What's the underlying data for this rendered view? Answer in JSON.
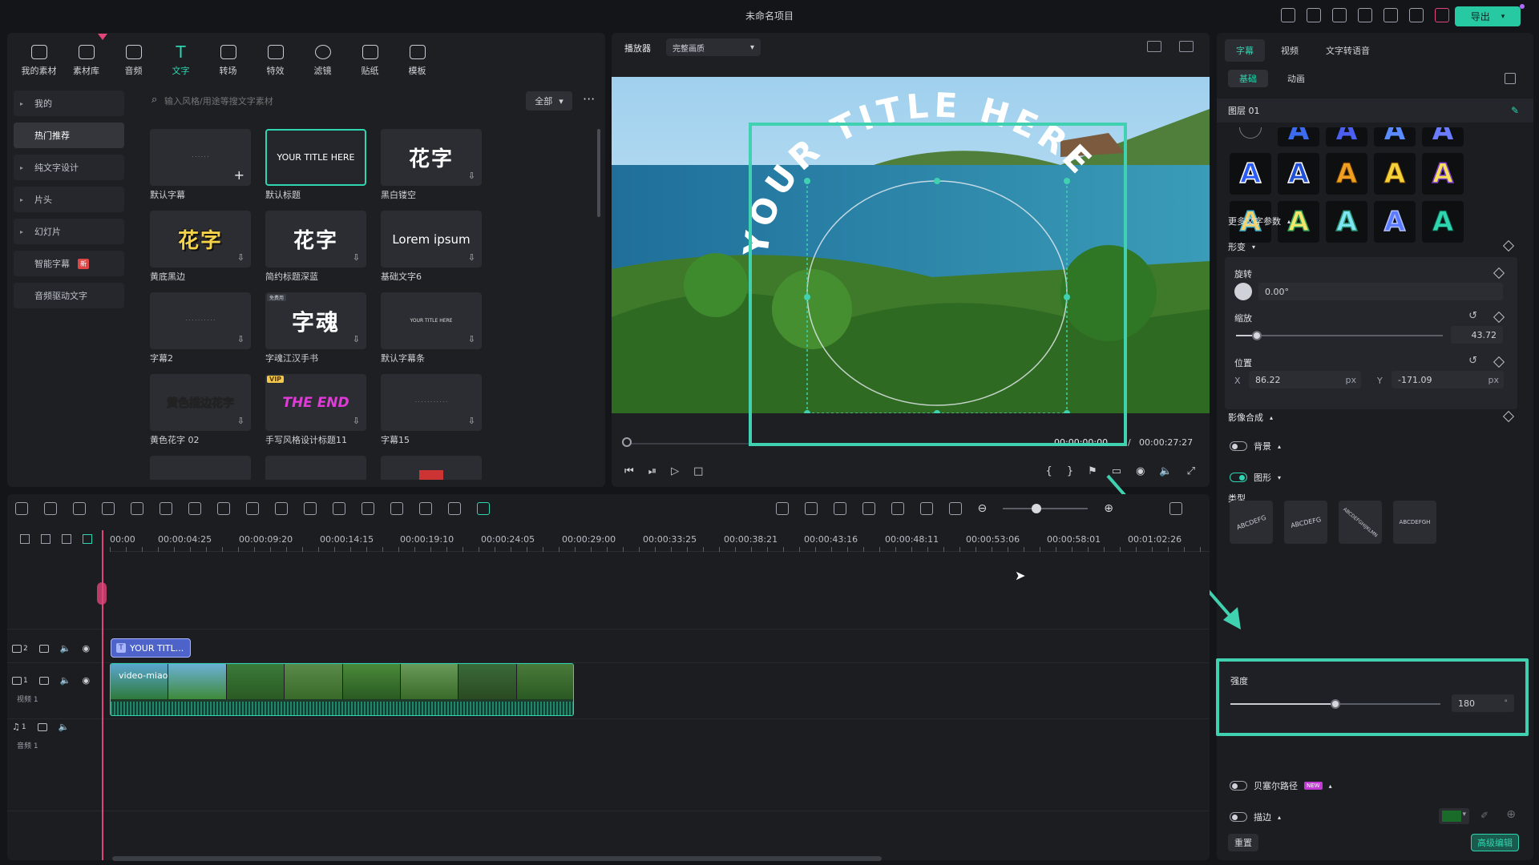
{
  "app": {
    "title": "未命名项目",
    "export_label": "导出"
  },
  "library": {
    "tools": [
      {
        "label": "我的素材",
        "icon": "my-media-icon"
      },
      {
        "label": "素材库",
        "icon": "stock-icon"
      },
      {
        "label": "音频",
        "icon": "audio-icon"
      },
      {
        "label": "文字",
        "icon": "text-icon"
      },
      {
        "label": "转场",
        "icon": "transition-icon"
      },
      {
        "label": "特效",
        "icon": "effects-icon"
      },
      {
        "label": "滤镜",
        "icon": "filter-icon"
      },
      {
        "label": "贴纸",
        "icon": "sticker-icon"
      },
      {
        "label": "模板",
        "icon": "template-icon"
      }
    ],
    "categories": [
      "我的",
      "热门推荐",
      "纯文字设计",
      "片头",
      "幻灯片",
      "智能字幕",
      "音频驱动文字"
    ],
    "smart_badge": "新",
    "search_placeholder": "输入风格/用途等搜文字素材",
    "filter_label": "全部",
    "cards": [
      {
        "label": "默认字幕",
        "preview": ""
      },
      {
        "label": "默认标题",
        "preview": "YOUR TITLE HERE"
      },
      {
        "label": "黑白镂空",
        "preview": "花字"
      },
      {
        "label": "黄底黑边",
        "preview": "花字"
      },
      {
        "label": "简约标题深蓝",
        "preview": "花字"
      },
      {
        "label": "基础文字6",
        "preview": "Lorem ipsum"
      },
      {
        "label": "字幕2",
        "preview": ""
      },
      {
        "label": "字魂江汉手书",
        "preview": "字魂"
      },
      {
        "label": "默认字幕条",
        "preview": "YOUR TITLE HERE"
      },
      {
        "label": "黄色花字 02",
        "preview": "黄色描边花字"
      },
      {
        "label": "手写风格设计标题11",
        "preview": "THE END"
      },
      {
        "label": "字幕15",
        "preview": ""
      }
    ],
    "vip": "VIP",
    "free_tag": "免费用"
  },
  "player": {
    "label": "播放器",
    "quality": "完整画质",
    "overlay_text": "YOUR TITLE HERE",
    "current_time": "00:00:00:00",
    "total_time": "00:00:27:27",
    "separator": "/"
  },
  "inspector": {
    "tabs": [
      "字幕",
      "视频",
      "文字转语音"
    ],
    "subtabs": [
      "基础",
      "动画"
    ],
    "layer": "图层 01",
    "more_params": "更多文字参数",
    "transform": "形变",
    "rotate_label": "旋转",
    "rotate_value": "0.00°",
    "scale_label": "缩放",
    "scale_value": "43.72",
    "scale_fraction": 0.1,
    "position_label": "位置",
    "pos_x_label": "X",
    "pos_x": "86.22",
    "pos_y_label": "Y",
    "pos_y": "-171.09",
    "unit_px": "px",
    "compositing": "影像合成",
    "background": "背景",
    "shape": "图形",
    "type_label": "类型",
    "type_samples": [
      "ABCDEFG",
      "ABCDEFG",
      "ABCDEFGHIJKLMN",
      "ABCDEFGH"
    ],
    "strength_label": "强度",
    "strength_value": "180",
    "strength_unit": "°",
    "strength_fraction": 0.5,
    "bezier": "贝塞尔路径",
    "bezier_badge": "NEW",
    "stroke": "描边",
    "stroke_color": "#1a6b2a",
    "reset": "重置",
    "advanced": "高级编辑"
  },
  "timeline": {
    "ticks": [
      "00:00",
      "00:00:04:25",
      "00:00:09:20",
      "00:00:14:15",
      "00:00:19:10",
      "00:00:24:05",
      "00:00:29:00",
      "00:00:33:25",
      "00:00:38:21",
      "00:00:43:16",
      "00:00:48:11",
      "00:00:53:06",
      "00:00:58:01",
      "00:01:02:26"
    ],
    "title_clip": "YOUR TITL...",
    "video_clip": "video-miao",
    "track2": "2",
    "track1": "1",
    "video_track_name": "视频 1",
    "audio_track": "1",
    "audio_track_name": "音频 1"
  },
  "colors": {
    "accent": "#2fd5b0",
    "highlight": "#3fd1b0",
    "playhead": "#e2457a"
  }
}
